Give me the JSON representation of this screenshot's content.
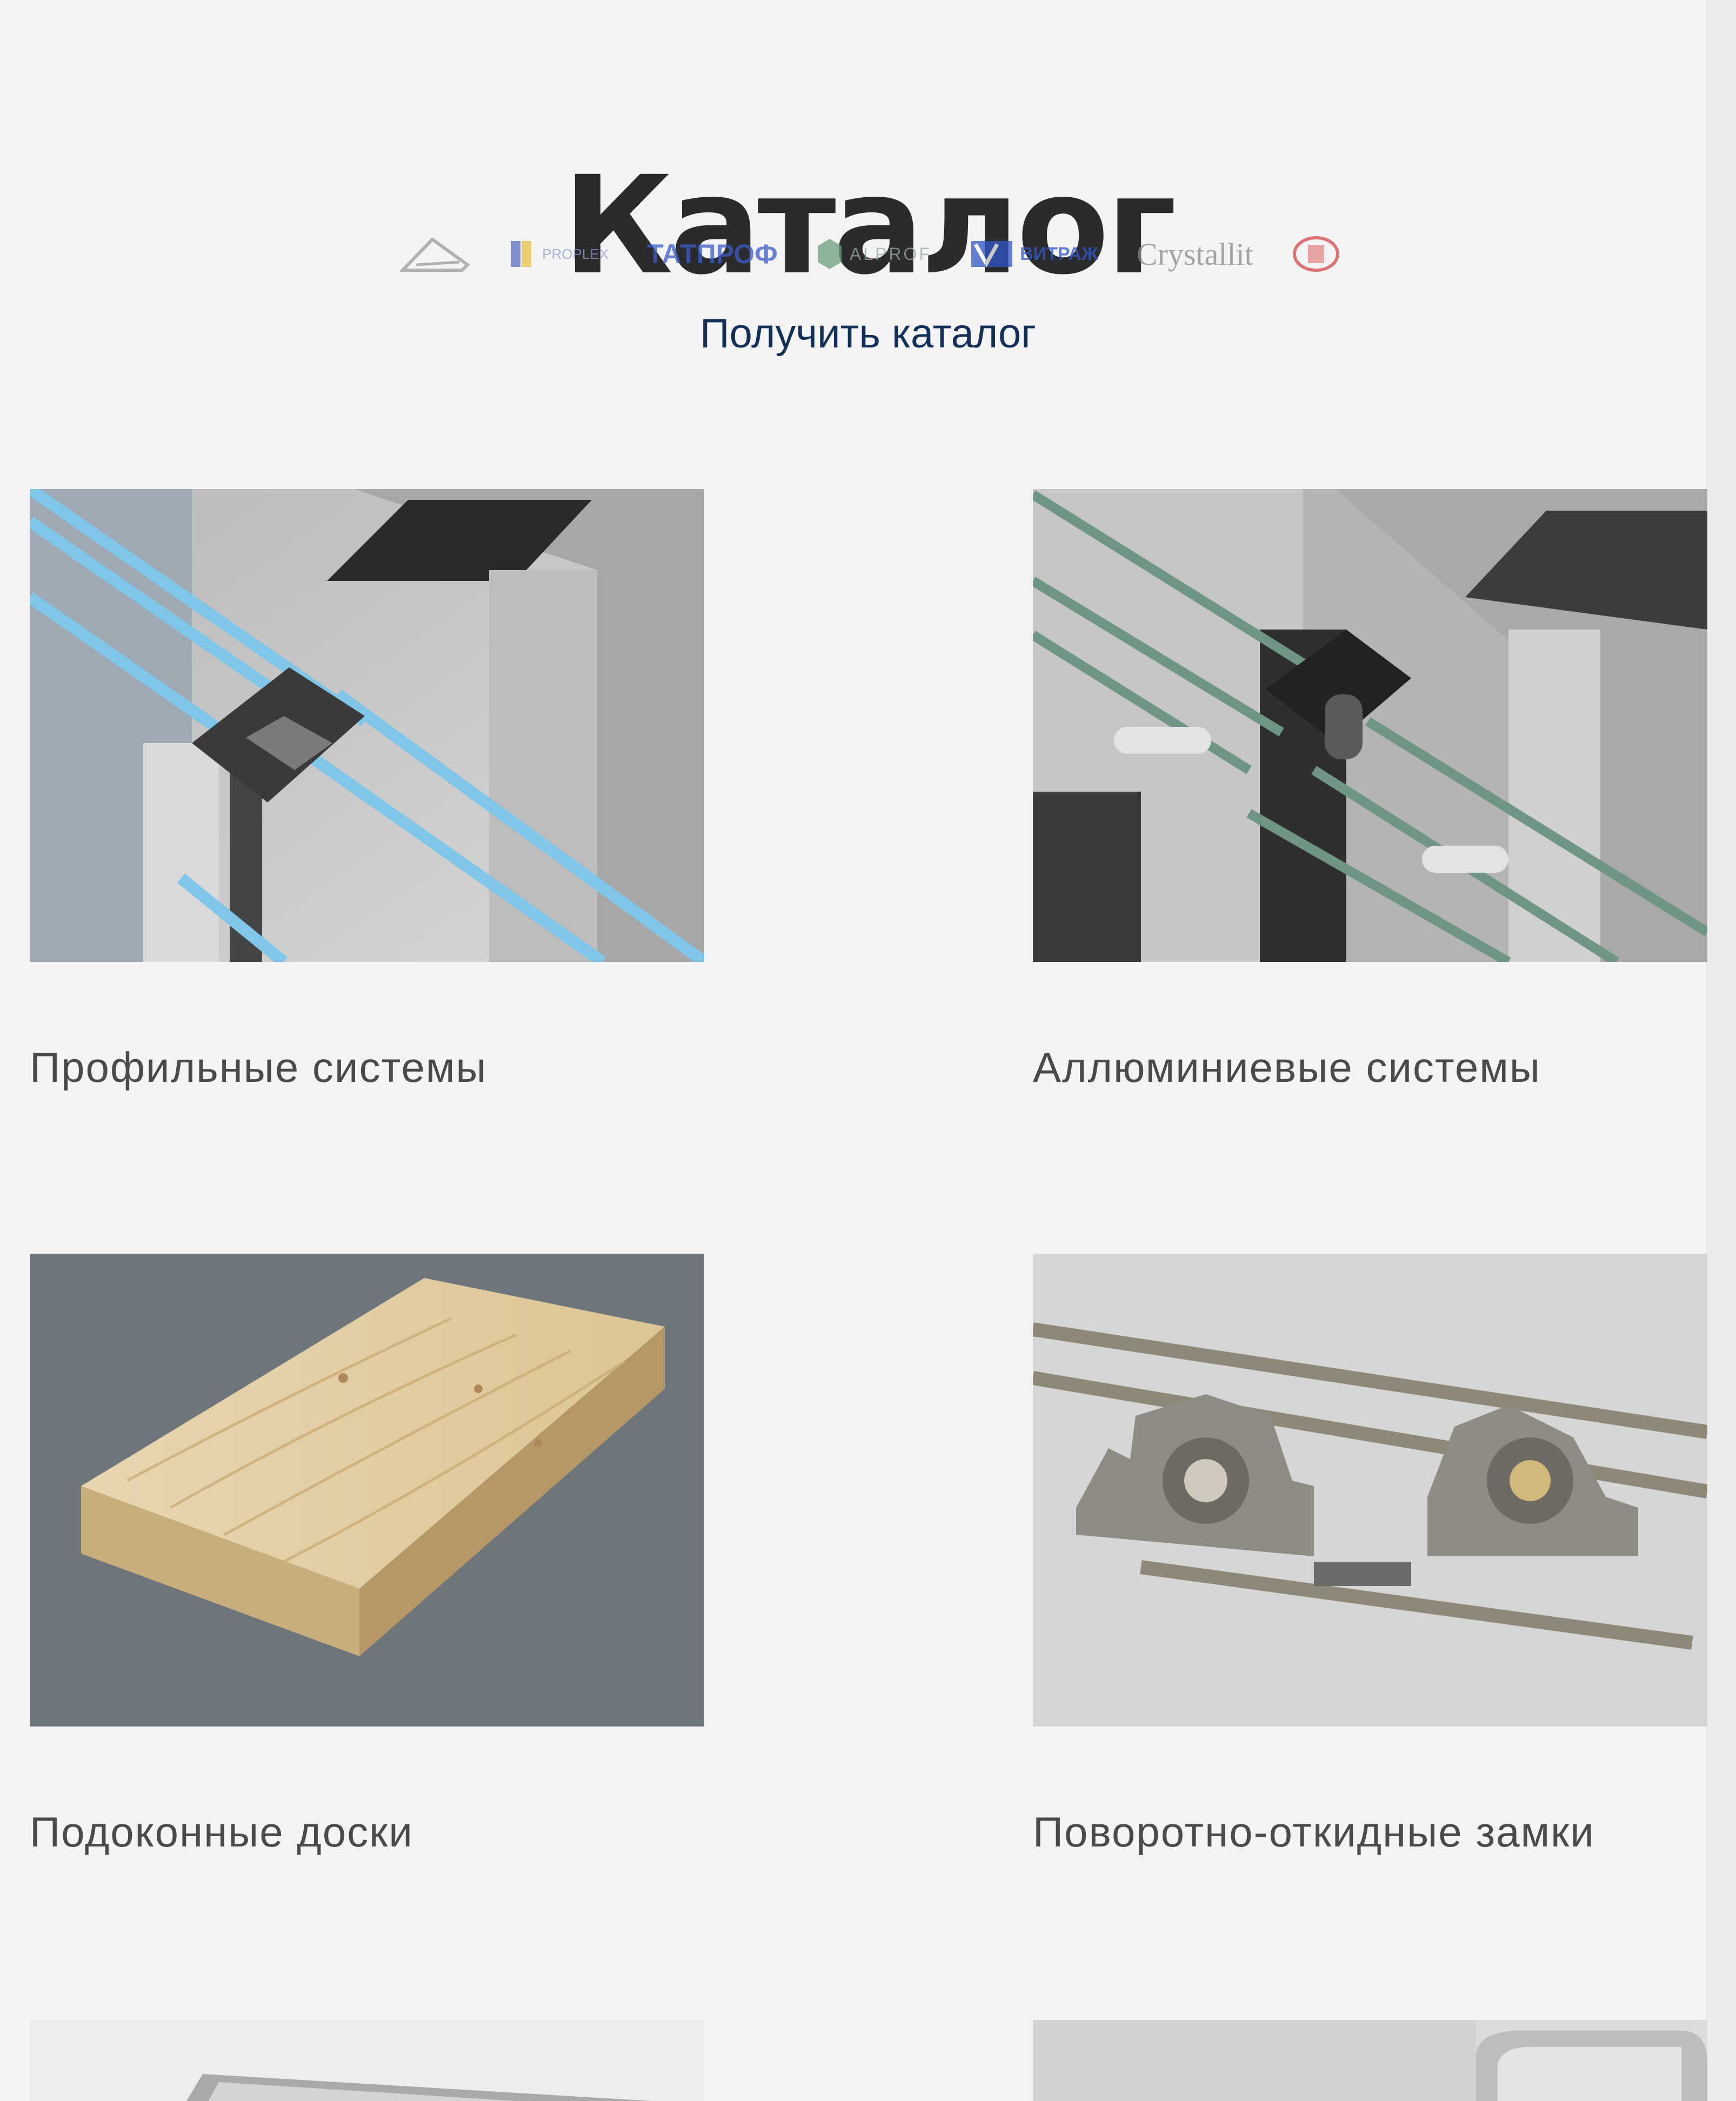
{
  "page": {
    "title": "Каталог"
  },
  "brands": [
    {
      "name": "montblanc",
      "icon": "roof-triangle-icon",
      "text": "",
      "color": "#8a8a8a"
    },
    {
      "name": "proplex",
      "icon": "flag-icon",
      "text": "PROPLEX",
      "color": "#5a6fc2"
    },
    {
      "name": "tatprof",
      "icon": "",
      "text": "ТАТПРОФ",
      "color": "#3d5ac8"
    },
    {
      "name": "alprof",
      "icon": "hexagon-icon",
      "text": "ALPROF",
      "color": "#6e9f7e"
    },
    {
      "name": "vitrazh",
      "icon": "v-icon",
      "text": "ВИТРАЖ",
      "color": "#2f57c9"
    },
    {
      "name": "crystallit",
      "icon": "",
      "text": "Crystallit",
      "color": "#8a8a8a"
    },
    {
      "name": "round-brand",
      "icon": "round-emblem-icon",
      "text": "",
      "color": "#d64a4a"
    }
  ],
  "cta": {
    "label": "Получить каталог"
  },
  "catalog": [
    {
      "label": "Профильные системы",
      "image": "profile-cutaway-image"
    },
    {
      "label": "Аллюминиевые системы",
      "image": "aluminum-profile-image"
    },
    {
      "label": "Подоконные доски",
      "image": "window-sill-board-image"
    },
    {
      "label": "Поворотно-откидные замки",
      "image": "tilt-turn-lock-image"
    },
    {
      "label": "",
      "image": "partial-product-image"
    },
    {
      "label": "",
      "image": "partial-product-image"
    }
  ]
}
